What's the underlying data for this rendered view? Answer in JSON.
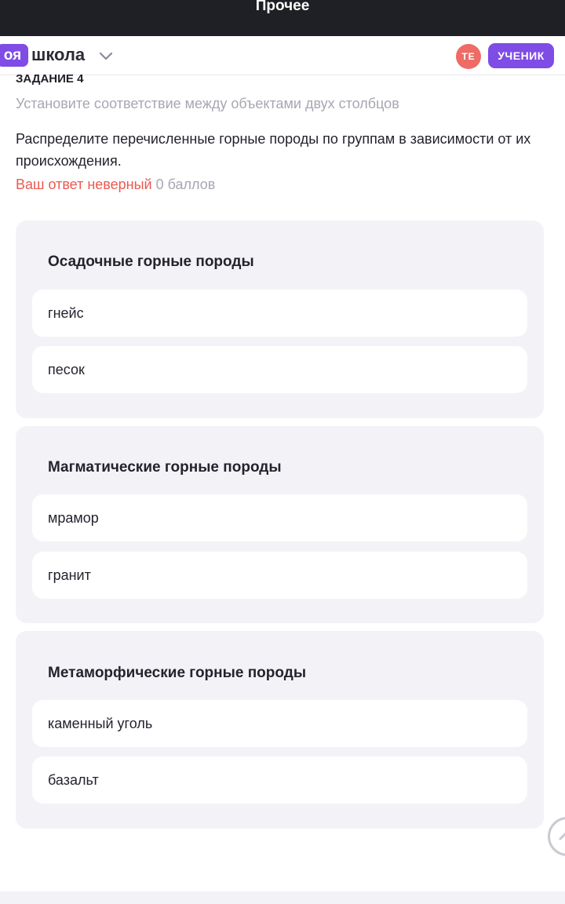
{
  "topbar": {
    "title": "Прочее"
  },
  "header": {
    "logo_badge": "оя",
    "logo_text": "школа",
    "avatar_initials": "TE",
    "role_label": "УЧЕНИК"
  },
  "task": {
    "label": "ЗАДАНИЕ 4",
    "subtitle": "Установите соответствие между объектами двух столбцов",
    "text": "Распределите перечисленные горные породы по группам в зависимости от их происхождения.",
    "result_status": "Ваш ответ неверный",
    "result_score": "0 баллов"
  },
  "groups": [
    {
      "title": "Осадочные горные породы",
      "items": [
        "гнейс",
        "песок"
      ]
    },
    {
      "title": "Магматические горные породы",
      "items": [
        "мрамор",
        "гранит"
      ]
    },
    {
      "title": "Метаморфические горные породы",
      "items": [
        "каменный уголь",
        "базальт"
      ]
    }
  ],
  "icons": {
    "logo_chevron": "chevron-down-icon",
    "scroll_top": "arrow-up-icon"
  },
  "colors": {
    "accent": "#7f4ce6",
    "topbar": "#1f2025",
    "error": "#ea5a50",
    "avatar": "#ee6b66",
    "muted": "#a7a7b3",
    "group_bg": "#f3f3f7"
  }
}
